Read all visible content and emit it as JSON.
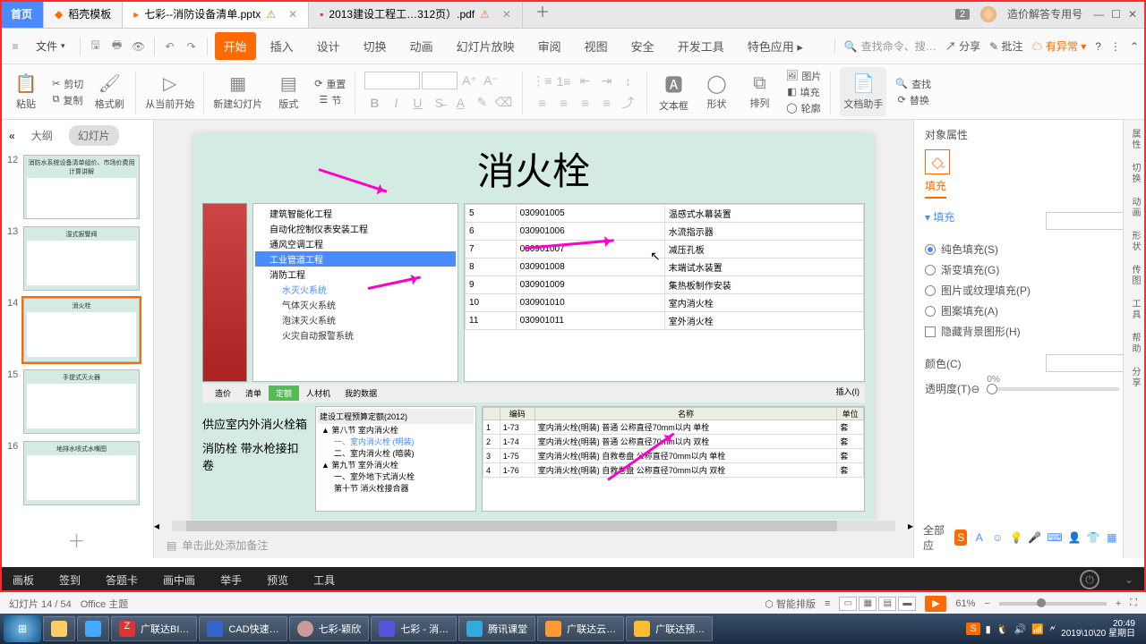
{
  "titlebar": {
    "home": "首页",
    "template": "稻壳模板",
    "tab_active": "七彩--消防设备清单.pptx",
    "tab_pdf": "2013建设工程工…312页）.pdf",
    "tab_badge": "2",
    "user": "造价解答专用号"
  },
  "menubar": {
    "file": "文件",
    "tabs": [
      "开始",
      "插入",
      "设计",
      "切换",
      "动画",
      "幻灯片放映",
      "审阅",
      "视图",
      "安全",
      "开发工具",
      "特色应用"
    ],
    "search_ph": "查找命令、搜…",
    "share": "分享",
    "comment": "批注",
    "abnormal": "有异常"
  },
  "ribbon": {
    "paste": "粘贴",
    "cut": "剪切",
    "copy": "复制",
    "brush": "格式刷",
    "from_begin": "从当前开始",
    "new_slide": "新建幻灯片",
    "layout": "版式",
    "section": "节",
    "reset": "重置",
    "textbox": "文本框",
    "shape": "形状",
    "arrange": "排列",
    "picture": "图片",
    "fill": "填充",
    "outline": "轮廓",
    "doc_help": "文档助手",
    "find": "查找",
    "replace": "替换"
  },
  "pane": {
    "outline": "大纲",
    "slides": "幻灯片"
  },
  "thumbs": [
    {
      "n": "12",
      "title": "消防水系统设备清单组价、市场价费用计算讲解"
    },
    {
      "n": "13",
      "title": "湿式报警阀"
    },
    {
      "n": "14",
      "title": "消火栓"
    },
    {
      "n": "15",
      "title": "手提式灭火器"
    },
    {
      "n": "16",
      "title": "地排水喷式水嘴图"
    }
  ],
  "slide": {
    "title": "消火栓",
    "tree": [
      "建筑智能化工程",
      "自动化控制仪表安装工程",
      "通风空调工程",
      "工业管道工程",
      "消防工程"
    ],
    "tree_sub": [
      "水灭火系统",
      "气体灭火系统",
      "泡沫灭火系统",
      "火灾自动报警系统"
    ],
    "table": [
      [
        "5",
        "030901005",
        "温感式水幕装置"
      ],
      [
        "6",
        "030901006",
        "水流指示器"
      ],
      [
        "7",
        "030901007",
        "减压孔板"
      ],
      [
        "8",
        "030901008",
        "末端试水装置"
      ],
      [
        "9",
        "030901009",
        "集热板制作安装"
      ],
      [
        "10",
        "030901010",
        "室内消火栓"
      ],
      [
        "11",
        "030901011",
        "室外消火栓"
      ]
    ],
    "left_text1": "供应室内外消火栓箱",
    "left_text2": "消防栓 带水枪接扣卷",
    "lower_tabs": [
      "造价",
      "清单",
      "定额",
      "人材机",
      "我的数据"
    ],
    "lower_insert": "插入(I)",
    "lower_std": "建设工程预算定额(2012)",
    "lower_tree": [
      "▲ 第八节  室内消火栓",
      "一、室内消火栓 (明装)",
      "二、室内消火栓 (暗装)",
      "▲ 第九节  室外消火栓",
      "一、室外地下式消火栓",
      "第十节  消火栓接合器"
    ],
    "lower_table_head": [
      "",
      "编码",
      "名称",
      "单位"
    ],
    "lower_table": [
      [
        "1",
        "1-73",
        "室内消火栓(明装) 普通 公称直径70mm以内 单栓",
        "套"
      ],
      [
        "2",
        "1-74",
        "室内消火栓(明装) 普通 公称直径70mm以内 双栓",
        "套"
      ],
      [
        "3",
        "1-75",
        "室内消火栓(明装) 自救卷盘 公称直径70mm以内 单栓",
        "套"
      ],
      [
        "4",
        "1-76",
        "室内消火栓(明装) 自救卷盘 公称直径70mm以内 双栓",
        "套"
      ]
    ]
  },
  "notes": "单击此处添加备注",
  "prop": {
    "title": "对象属性",
    "tab": "填充",
    "section": "填充",
    "radios": [
      "纯色填充(S)",
      "渐变填充(G)",
      "图片或纹理填充(P)",
      "图案填充(A)"
    ],
    "check": "隐藏背景图形(H)",
    "color": "颜色(C)",
    "opacity": "透明度(T)",
    "opacity_val": "0%",
    "footer": "全部应"
  },
  "rail": [
    "属性",
    "切换",
    "动画",
    "形状",
    "传图",
    "工具",
    "帮助",
    "分享"
  ],
  "blackbar": [
    "画板",
    "签到",
    "答题卡",
    "画中画",
    "举手",
    "预览",
    "工具"
  ],
  "status": {
    "slide": "幻灯片 14 / 54",
    "theme": "Office 主题",
    "smart": "智能排版",
    "zoom": "61%"
  },
  "taskbar": {
    "items": [
      "广联达BI…",
      "CAD快速…",
      "七彩-颖欣",
      "七彩 - 消…",
      "腾讯课堂",
      "广联达云…",
      "广联达预…"
    ],
    "time": "20:49",
    "date": "2019\\10\\20 星期日"
  }
}
